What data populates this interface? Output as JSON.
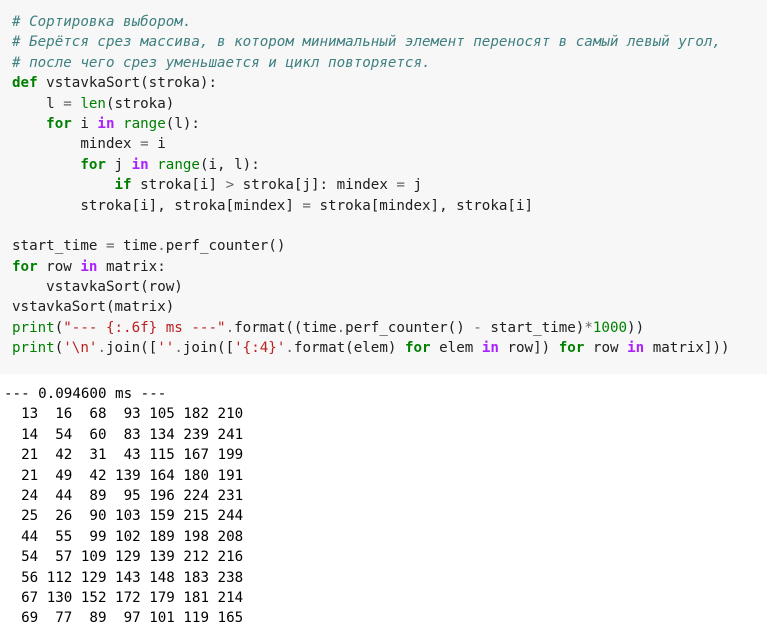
{
  "code_cell": {
    "lines": [
      [
        [
          "c",
          "# Сортировка выбором."
        ]
      ],
      [
        [
          "c",
          "# Берётся срез массива, в котором минимальный элемент переносят в самый левый угол,"
        ]
      ],
      [
        [
          "c",
          "# после чего срез уменьшается и цикл повторяется."
        ]
      ],
      [
        [
          "k",
          "def"
        ],
        [
          "p",
          " vstavkaSort(stroka):"
        ]
      ],
      [
        [
          "p",
          "    l "
        ],
        [
          "m",
          "="
        ],
        [
          "p",
          " "
        ],
        [
          "n",
          "len"
        ],
        [
          "p",
          "(stroka)"
        ]
      ],
      [
        [
          "p",
          "    "
        ],
        [
          "k",
          "for"
        ],
        [
          "p",
          " i "
        ],
        [
          "o",
          "in"
        ],
        [
          "p",
          " "
        ],
        [
          "n",
          "range"
        ],
        [
          "p",
          "(l):"
        ]
      ],
      [
        [
          "p",
          "        mindex "
        ],
        [
          "m",
          "="
        ],
        [
          "p",
          " i"
        ]
      ],
      [
        [
          "p",
          "        "
        ],
        [
          "k",
          "for"
        ],
        [
          "p",
          " j "
        ],
        [
          "o",
          "in"
        ],
        [
          "p",
          " "
        ],
        [
          "n",
          "range"
        ],
        [
          "p",
          "(i, l):"
        ]
      ],
      [
        [
          "p",
          "            "
        ],
        [
          "k",
          "if"
        ],
        [
          "p",
          " stroka[i] "
        ],
        [
          "m",
          ">"
        ],
        [
          "p",
          " stroka[j]: mindex "
        ],
        [
          "m",
          "="
        ],
        [
          "p",
          " j"
        ]
      ],
      [
        [
          "p",
          "        stroka[i], stroka[mindex] "
        ],
        [
          "m",
          "="
        ],
        [
          "p",
          " stroka[mindex], stroka[i]"
        ]
      ],
      [
        [
          "p",
          ""
        ]
      ],
      [
        [
          "p",
          "start_time "
        ],
        [
          "m",
          "="
        ],
        [
          "p",
          " time"
        ],
        [
          "m",
          "."
        ],
        [
          "p",
          "perf_counter()"
        ]
      ],
      [
        [
          "k",
          "for"
        ],
        [
          "p",
          " row "
        ],
        [
          "o",
          "in"
        ],
        [
          "p",
          " matrix:"
        ]
      ],
      [
        [
          "p",
          "    vstavkaSort(row)"
        ]
      ],
      [
        [
          "p",
          "vstavkaSort(matrix)"
        ]
      ],
      [
        [
          "n",
          "print"
        ],
        [
          "p",
          "("
        ],
        [
          "s",
          "\"--- {:.6f} ms ---\""
        ],
        [
          "m",
          "."
        ],
        [
          "p",
          "format((time"
        ],
        [
          "m",
          "."
        ],
        [
          "p",
          "perf_counter() "
        ],
        [
          "m",
          "-"
        ],
        [
          "p",
          " start_time)"
        ],
        [
          "m",
          "*"
        ],
        [
          "n",
          "1000"
        ],
        [
          "p",
          "))"
        ]
      ],
      [
        [
          "n",
          "print"
        ],
        [
          "p",
          "("
        ],
        [
          "s",
          "'\\n'"
        ],
        [
          "m",
          "."
        ],
        [
          "p",
          "join(["
        ],
        [
          "s",
          "''"
        ],
        [
          "m",
          "."
        ],
        [
          "p",
          "join(["
        ],
        [
          "s",
          "'{:4}'"
        ],
        [
          "m",
          "."
        ],
        [
          "p",
          "format(elem) "
        ],
        [
          "k",
          "for"
        ],
        [
          "p",
          " elem "
        ],
        [
          "o",
          "in"
        ],
        [
          "p",
          " row]) "
        ],
        [
          "k",
          "for"
        ],
        [
          "p",
          " row "
        ],
        [
          "o",
          "in"
        ],
        [
          "p",
          " matrix]))"
        ]
      ]
    ]
  },
  "output": {
    "lines": [
      "--- 0.094600 ms ---",
      "  13  16  68  93 105 182 210",
      "  14  54  60  83 134 239 241",
      "  21  42  31  43 115 167 199",
      "  21  49  42 139 164 180 191",
      "  24  44  89  95 196 224 231",
      "  25  26  90 103 159 215 244",
      "  44  55  99 102 189 198 208",
      "  54  57 109 129 139 212 216",
      "  56 112 129 143 148 183 238",
      "  67 130 152 172 179 181 214",
      "  69  77  89  97 101 119 165"
    ]
  },
  "colors": {
    "cell_background": "#f7f7f7",
    "comment": "#408080",
    "keyword": "#008000",
    "operator_word": "#aa22ff",
    "string": "#ba2121",
    "operator": "#666666"
  }
}
